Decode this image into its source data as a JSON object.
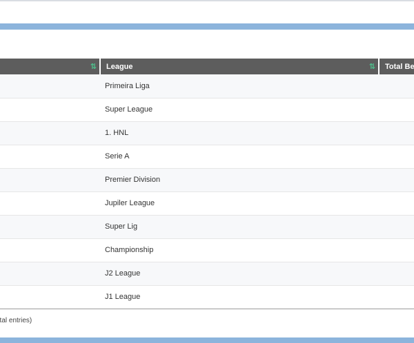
{
  "table": {
    "headers": [
      "",
      "League",
      "Total Bet"
    ],
    "rows": [
      {
        "col1": "",
        "league": "Primeira Liga",
        "total": ""
      },
      {
        "col1": "",
        "league": "Super League",
        "total": ""
      },
      {
        "col1": "",
        "league": "1. HNL",
        "total": ""
      },
      {
        "col1": "",
        "league": "Serie A",
        "total": ""
      },
      {
        "col1": "",
        "league": "Premier Division",
        "total": ""
      },
      {
        "col1": "",
        "league": "Jupiler League",
        "total": ""
      },
      {
        "col1": "",
        "league": "Super Lig",
        "total": ""
      },
      {
        "col1": "",
        "league": "Championship",
        "total": ""
      },
      {
        "col1": "",
        "league": "J2 League",
        "total": ""
      },
      {
        "col1": "",
        "league": "J1 League",
        "total": ""
      }
    ],
    "sort_icon": "⇅"
  },
  "footer": {
    "info": "otal entries)"
  },
  "colors": {
    "header_bg": "#5d5d5d",
    "accent_bar": "#8cb4dc",
    "sort_icon": "#4fc08d"
  }
}
